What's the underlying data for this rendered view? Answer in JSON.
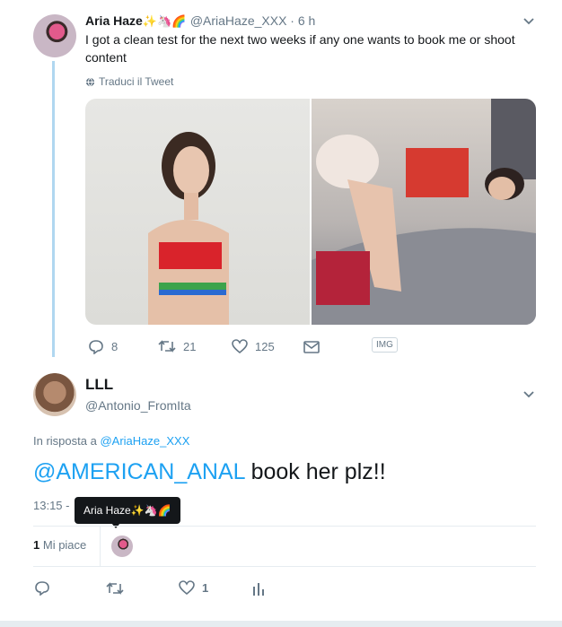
{
  "tweet1": {
    "name": "Aria Haze",
    "name_emoji": "✨🦄🌈",
    "handle": "@AriaHaze_XXX · 6 h",
    "text": "I got a clean test for the next two weeks if any one wants to book me or shoot content",
    "translate": "Traduci il Tweet",
    "actions": {
      "replies": "8",
      "retweets": "21",
      "likes": "125"
    },
    "img_label": "IMG"
  },
  "tweet2": {
    "name": "LLL",
    "handle": "@Antonio_FromIta",
    "reply_prefix": "In risposta a",
    "reply_to": "@AriaHaze_XXX",
    "mention": "@AMERICAN_ANAL",
    "text_rest": " book her plz!!",
    "time": "13:15 -",
    "likes_count": "1",
    "likes_label": "Mi piace",
    "tooltip": "Aria Haze✨🦄🌈",
    "action_likes": "1"
  },
  "colors": {
    "link": "#1da1f2",
    "muted": "#657786",
    "thread": "#b0d7f0"
  }
}
